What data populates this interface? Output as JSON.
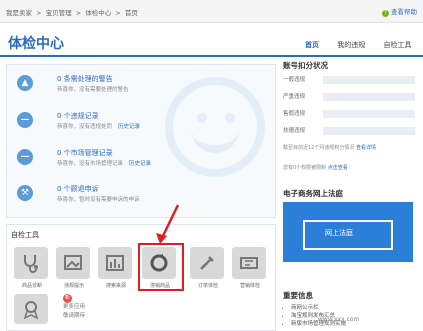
{
  "breadcrumbs": [
    "我是卖家",
    ">",
    "宝贝管理",
    ">",
    "体检中心",
    ">",
    "首页"
  ],
  "help_link": "查看帮助",
  "page_title": "体检中心",
  "tabs": [
    {
      "label": "首页",
      "active": true
    },
    {
      "label": "我的违规",
      "active": false
    },
    {
      "label": "自检工具",
      "active": false
    }
  ],
  "health_rows": [
    {
      "icon": "bell-icon",
      "title": "0 条需处理的警告",
      "sub": "恭喜你，没有需要处理的警告",
      "link": ""
    },
    {
      "icon": "minus-icon",
      "title": "0 个违规记录",
      "sub": "恭喜你，没有违规处罚",
      "link": "历史记录"
    },
    {
      "icon": "minus-icon",
      "title": "0 个市场管理记录",
      "sub": "恭喜你，没有市场管理记录",
      "link": "历史记录"
    },
    {
      "icon": "gavel-icon",
      "title": "0 个顾退申诉",
      "sub": "恭喜你，暂时没有需要申诉的申诉",
      "link": ""
    }
  ],
  "tools": {
    "title": "自检工具",
    "items": [
      "商品诊断",
      "违规提示",
      "搜索来源",
      "滞销商品",
      "订单体检",
      "营销体检"
    ],
    "extra": [
      "更多应用",
      "敬请期待"
    ],
    "badge": "新"
  },
  "account": {
    "title": "账号扣分状况",
    "rows": [
      "一般违规",
      "严重违规",
      "售假违规",
      "扶德违规"
    ],
    "note": "截至目前近12个月违规积分情况",
    "note_link": "查看详情",
    "note2": "您有0个权限被限制",
    "note2_link": "点击查看"
  },
  "law": {
    "title": "电子商务网上法庭",
    "banner": "网上法庭"
  },
  "news": {
    "title": "重要信息",
    "items": [
      "商网公示栏",
      "淘宝规则发布汇总",
      "新版市场管理规则实施"
    ]
  },
  "watermark": "www.xxx.com"
}
